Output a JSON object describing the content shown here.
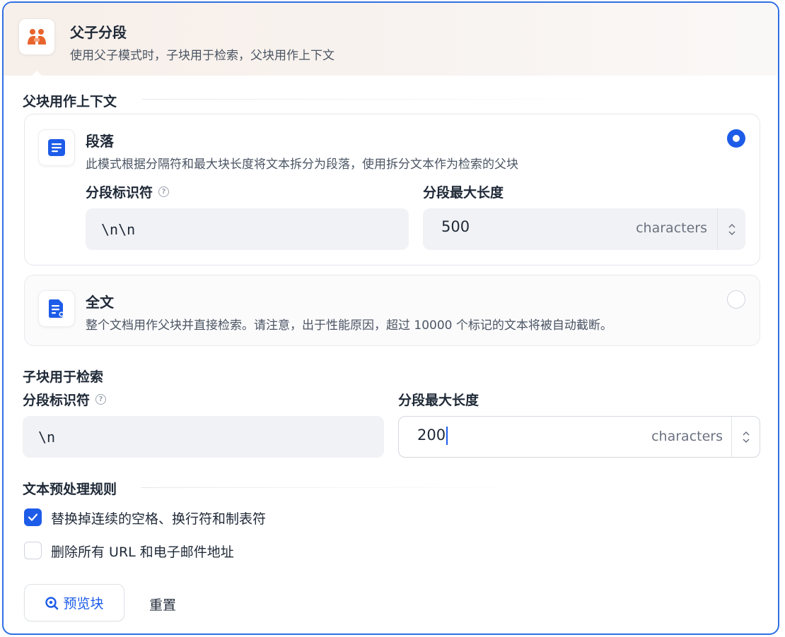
{
  "header": {
    "title": "父子分段",
    "description": "使用父子模式时，子块用于检索，父块用作上下文",
    "icon": "parent-child-icon"
  },
  "parent_section": {
    "title": "父块用作上下文",
    "options": [
      {
        "title": "段落",
        "description": "此模式根据分隔符和最大块长度将文本拆分为段落，使用拆分文本作为检索的父块",
        "selected": true,
        "icon": "paragraph-icon",
        "delimiter_label": "分段标识符",
        "delimiter_value": "\\n\\n",
        "max_length_label": "分段最大长度",
        "max_length_value": "500",
        "unit": "characters"
      },
      {
        "title": "全文",
        "description": "整个文档用作父块并直接检索。请注意，出于性能原因，超过 10000 个标记的文本将被自动截断。",
        "selected": false,
        "icon": "document-icon"
      }
    ]
  },
  "child_section": {
    "title": "子块用于检索",
    "delimiter_label": "分段标识符",
    "delimiter_value": "\\n",
    "max_length_label": "分段最大长度",
    "max_length_value": "200",
    "unit": "characters"
  },
  "preprocess": {
    "title": "文本预处理规则",
    "rules": [
      {
        "label": "替换掉连续的空格、换行符和制表符",
        "checked": true
      },
      {
        "label": "删除所有 URL 和电子邮件地址",
        "checked": false
      }
    ]
  },
  "actions": {
    "preview_label": "预览块",
    "reset_label": "重置"
  },
  "colors": {
    "accent": "#1d5ce8",
    "border": "#2f6fe4",
    "brand_orange": "#e8642c"
  }
}
